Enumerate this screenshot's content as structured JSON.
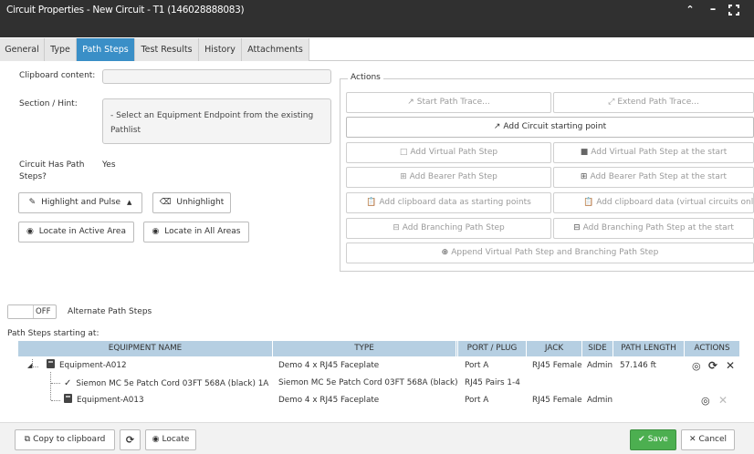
{
  "window": {
    "title": "Circuit Properties - New Circuit - T1 (146028888083)",
    "controls": [
      "chevron-up-icon",
      "minimize-icon",
      "expand-icon"
    ]
  },
  "tabs": [
    {
      "label": "General",
      "active": false
    },
    {
      "label": "Type",
      "active": false
    },
    {
      "label": "Path Steps",
      "active": true
    },
    {
      "label": "Test Results",
      "active": false
    },
    {
      "label": "History",
      "active": false
    },
    {
      "label": "Attachments",
      "active": false
    }
  ],
  "form": {
    "clipboard_label": "Clipboard content:",
    "clipboard_value": "",
    "hint_label": "Section / Hint:",
    "hint_value": "- Select an Equipment Endpoint from the existing Pathlist",
    "has_path_steps_label": "Circuit Has Path Steps?",
    "has_path_steps_value": "Yes"
  },
  "left_buttons": {
    "highlight": "Highlight and Pulse",
    "unhighlight": "Unhighlight",
    "locate_active": "Locate in Active Area",
    "locate_all": "Locate in All Areas"
  },
  "actions": {
    "legend": "Actions",
    "start_trace": "Start Path Trace...",
    "extend_trace": "Extend Path Trace...",
    "add_start": "Add Circuit starting point",
    "add_virtual": "Add Virtual Path Step",
    "add_virtual_start": "Add Virtual Path Step at the start",
    "add_bearer": "Add Bearer Path Step",
    "add_bearer_start": "Add Bearer Path Step at the start",
    "add_clip_start": "Add clipboard data as starting points",
    "add_clip_virtual": "Add clipboard data (virtual circuits only)",
    "add_branch": "Add Branching Path Step",
    "add_branch_start": "Add Branching Path Step at the start",
    "append_virtual_branch": "Append Virtual Path Step and Branching Path Step"
  },
  "alternate": {
    "toggle_state": "OFF",
    "label": "Alternate Path Steps"
  },
  "grid": {
    "caption": "Path Steps starting at:",
    "columns": [
      "EQUIPMENT NAME",
      "TYPE",
      "PORT / PLUG",
      "JACK",
      "SIDE",
      "PATH LENGTH",
      "ACTIONS"
    ],
    "rows": [
      {
        "name": "Equipment-A012",
        "type": "Demo 4 x RJ45 Faceplate",
        "port": "Port A",
        "jack": "RJ45 Female",
        "side": "Admin",
        "length": "57.146 ft",
        "icon": "equipment-icon"
      },
      {
        "name": "Siemon MC 5e Patch Cord 03FT 568A (black) 1A",
        "type": "Siemon MC 5e Patch Cord 03FT 568A (black)",
        "port": "RJ45 Pairs 1-4",
        "jack": "",
        "side": "",
        "length": "",
        "icon": "cable-icon"
      },
      {
        "name": "Equipment-A013",
        "type": "Demo 4 x RJ45 Faceplate",
        "port": "Port A",
        "jack": "RJ45 Female",
        "side": "Admin",
        "length": "",
        "icon": "equipment-icon"
      }
    ]
  },
  "footer": {
    "copy": "Copy to clipboard",
    "locate": "Locate",
    "save": "Save",
    "cancel": "Cancel"
  },
  "colors": {
    "titlebar": "#303030",
    "tab_active": "#3a8fc7",
    "grid_header": "#b6cfe2",
    "save": "#4caf50"
  }
}
